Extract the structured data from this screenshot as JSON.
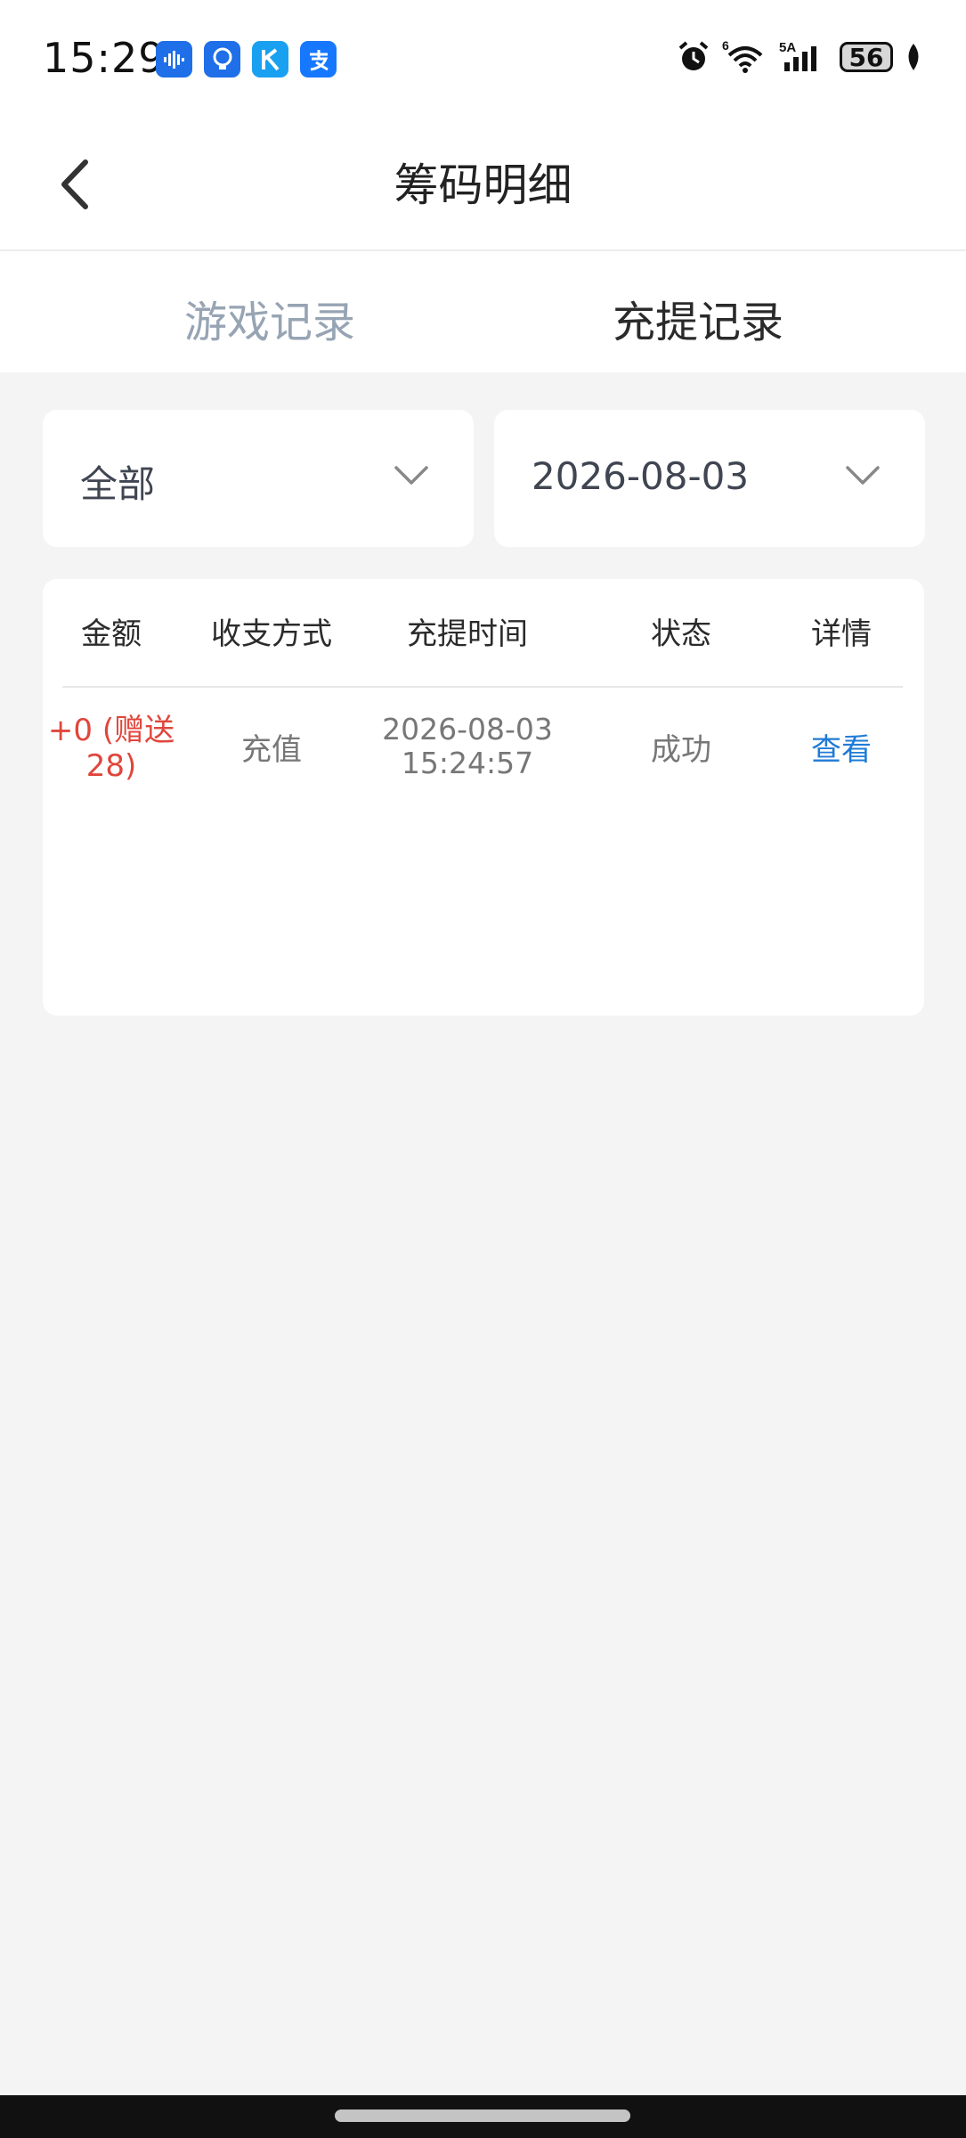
{
  "status_bar": {
    "time": "15:29",
    "battery": "56",
    "icons": [
      "voice-app-icon",
      "lightbulb-app-icon",
      "k-app-icon",
      "alipay-app-icon",
      "alarm-icon",
      "wifi-icon",
      "signal-icon",
      "battery-icon",
      "leaf-icon"
    ],
    "wifi_badge": "6",
    "signal_badge": "5A"
  },
  "header": {
    "title": "筹码明细"
  },
  "tabs": [
    {
      "label": "游戏记录",
      "active": false
    },
    {
      "label": "充提记录",
      "active": true
    }
  ],
  "filters": {
    "type": "全部",
    "date": "2026-08-03"
  },
  "table": {
    "columns": [
      "金额",
      "收支方式",
      "充提时间",
      "状态",
      "详情"
    ],
    "rows": [
      {
        "amount_line1": "+0 (赠送",
        "amount_line2": "28)",
        "method": "充值",
        "time_line1": "2026-08-03",
        "time_line2": "15:24:57",
        "status": "成功",
        "detail": "查看"
      }
    ]
  },
  "colors": {
    "accent_link": "#1f7bd6",
    "amount_red": "#e0463c",
    "inactive_tab": "#97a4b4",
    "page_bg": "#f4f4f4"
  }
}
